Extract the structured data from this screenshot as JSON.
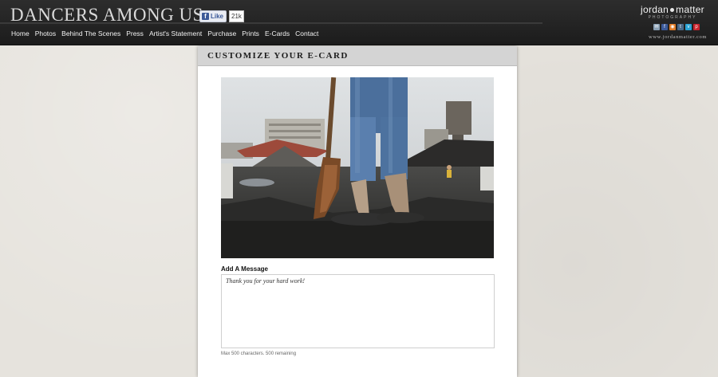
{
  "site": {
    "title": "DANCERS AMONG US",
    "fb_like_label": "Like",
    "fb_like_count": "21k",
    "nav": [
      "Home",
      "Photos",
      "Behind The Scenes",
      "Press",
      "Artist's Statement",
      "Purchase",
      "Prints",
      "E-Cards",
      "Contact"
    ],
    "logo_name_left": "jordan",
    "logo_name_right": "matter",
    "logo_sub": "PHOTOGRAPHY",
    "url": "www.jordanmatter.com",
    "social_icons": [
      "email-icon",
      "facebook-icon",
      "rss-icon",
      "tumblr-icon",
      "vimeo-icon",
      "pinterest-icon"
    ],
    "social_colors": [
      "#8aa0b5",
      "#3b5998",
      "#e07b27",
      "#4a6a8a",
      "#2aa4d5",
      "#c8232c"
    ]
  },
  "ecard": {
    "heading": "CUSTOMIZE YOUR E-CARD",
    "message_label": "Add A Message",
    "message_value": "Thank you for your hard work!",
    "counter": "Max 500 characters. 500 remaining"
  }
}
